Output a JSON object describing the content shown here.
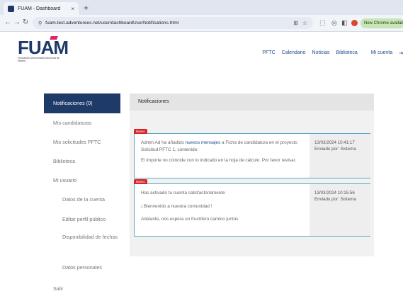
{
  "browser": {
    "tab_title": "FUAM - Dashboard",
    "tab_close": "×",
    "new_tab": "+",
    "url": "fuam.test.adventurees.net/user/dashboardUserNotifications.html",
    "chrome_update": "New Chrome available"
  },
  "site": {
    "logo_text": "FUAM",
    "logo_subtitle": "Fundación Universidad Autónoma de Madrid",
    "nav": [
      "PFTC",
      "Calendario",
      "Noticias",
      "Biblioteca"
    ],
    "account": "Mi cuenta"
  },
  "sidebar": {
    "active": "Notificaciones (0)",
    "items": [
      "Mis candidaturas",
      "Mis solicitudes PFTC",
      "Biblioteca",
      "Mi usuario"
    ],
    "subitems": [
      "Datos de la cuenta",
      "Editar perfil público",
      "Disponibilidad de fechas",
      "Datos personales"
    ],
    "logout": "Salir"
  },
  "panel": {
    "title": "Notificaciones"
  },
  "notifications": [
    {
      "badge": "Nuevo",
      "line1_prefix": "Admin Ad ha añadido ",
      "line1_link": "nuevos mensajes",
      "line1_suffix": " a Ficha de candidatura en el proyecto Solicitud PFTC 1, contenido:",
      "line2": "El importe no coincide con lo indicado en la hoja de cálculo. Por favor revisar.",
      "date": "13/03/2024 10:41:17",
      "sender": "Enviado por: Sistema"
    },
    {
      "badge": "Nuevo",
      "line1": "Has activado tu cuenta satisfactoriamente",
      "line2": "¡ Bienvenido a nuestra comunidad !",
      "line3": "Adelante, nos espera un fructífero camino juntos",
      "date": "13/03/2024 10:15:56",
      "sender": "Enviado por: Sistema"
    }
  ],
  "colors": {
    "brand": "#1e3a68",
    "accent": "#e0246a",
    "badge": "#d7262a",
    "notif_border": "#5ba7c6"
  }
}
